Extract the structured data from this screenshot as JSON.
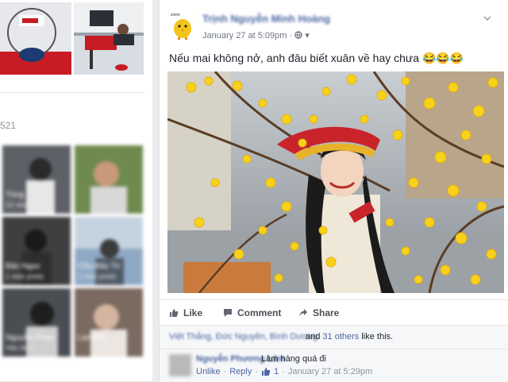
{
  "left_column": {
    "count_partial": "521",
    "friends": [
      {
        "name": "Tùng",
        "sub": "10 new posts"
      },
      {
        "name": "",
        "sub": ""
      },
      {
        "name": "Bảo Ngọc",
        "sub": "1 new posts"
      },
      {
        "name": "Chu Bảo Trí",
        "sub": "1 new posts"
      },
      {
        "name": "Nguyễn Phan",
        "sub": "Vân Anh"
      },
      {
        "name": "Lan Phi",
        "sub": ""
      }
    ]
  },
  "post": {
    "author": "Trịnh Nguyễn Minh Hoàng",
    "date": "January 27 at 5:09pm",
    "text": "Nếu mai không nở, anh đâu biết xuân về hay chưa 😂😂😂",
    "actions": {
      "like": "Like",
      "comment": "Comment",
      "share": "Share"
    },
    "likes": {
      "names": "Việt Thắng, Đức Nguyên, Bình Dương",
      "conjunction": "and",
      "others_link": "31 others",
      "suffix": "like this."
    },
    "comment": {
      "author": "Nguyễn Phương Lâm",
      "text": "Làm hàng quá đi",
      "unlike": "Unlike",
      "reply": "Reply",
      "like_count": "1",
      "time": "January 27 at 5:29pm"
    }
  },
  "colors": {
    "link": "#4b67a1",
    "background": "#e9ebee",
    "card": "#ffffff"
  },
  "icons": [
    "globe-icon",
    "chevron-down-icon",
    "like-icon",
    "comment-icon",
    "share-icon",
    "thumbs-up-icon"
  ]
}
